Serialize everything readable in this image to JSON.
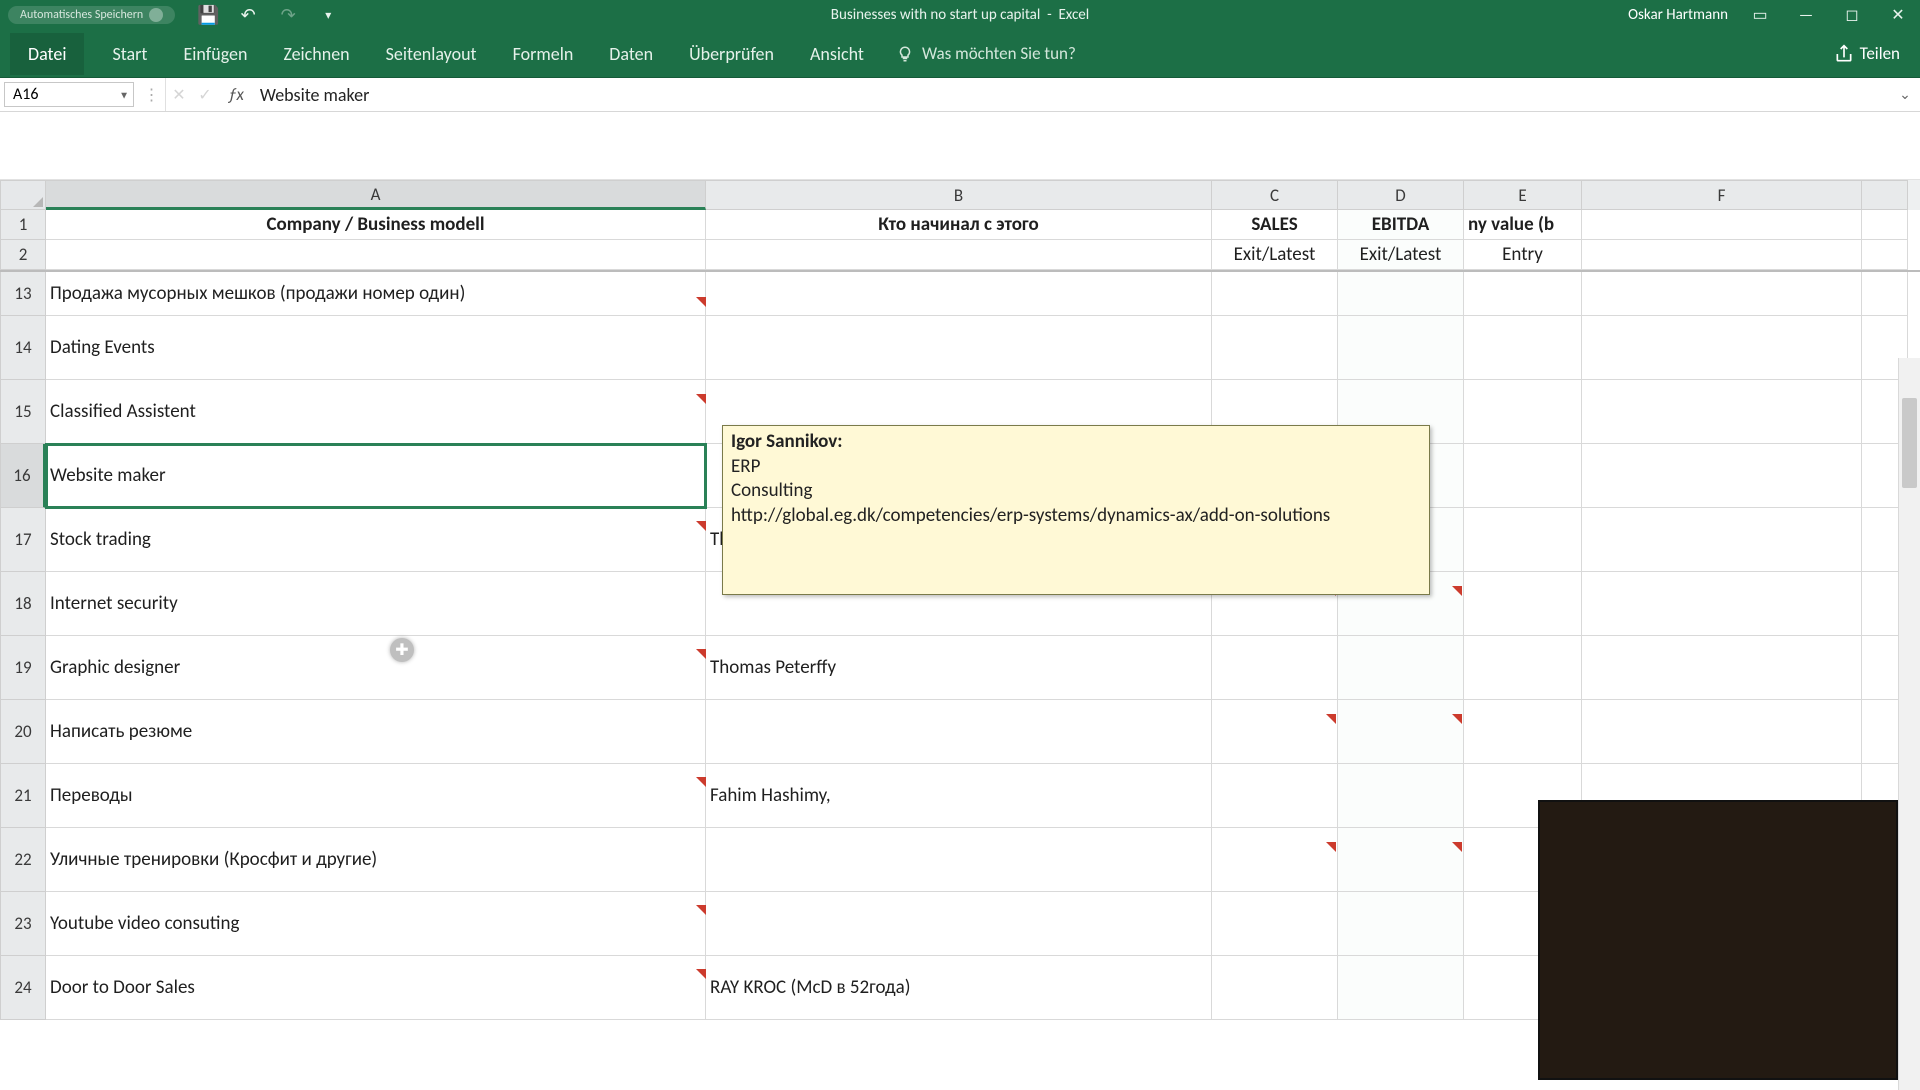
{
  "title": {
    "autosave": "Automatisches Speichern",
    "docname": "Businesses with no start up capital",
    "appname": "Excel",
    "user": "Oskar Hartmann"
  },
  "tabs": {
    "file": "Datei",
    "items": [
      "Start",
      "Einfügen",
      "Zeichnen",
      "Seitenlayout",
      "Formeln",
      "Daten",
      "Überprüfen",
      "Ansicht"
    ],
    "tellme_placeholder": "Was möchten Sie tun?",
    "share": "Teilen"
  },
  "formula": {
    "namebox": "A16",
    "value": "Website maker"
  },
  "columns": [
    "A",
    "B",
    "C",
    "D",
    "E",
    "F"
  ],
  "headers": {
    "A": "Company  / Business modell",
    "B": "Кто начинал с этого",
    "C": "SALES",
    "D": "EBITDA",
    "E_partial": "ny value (b"
  },
  "subheaders": {
    "C": "Exit/Latest",
    "D": "Exit/Latest",
    "E": "Entry"
  },
  "rows": [
    {
      "n": 13,
      "A": "Продажа мусорных мешков (продажи номер один)",
      "B": ""
    },
    {
      "n": 14,
      "A": "Dating Events",
      "B": ""
    },
    {
      "n": 15,
      "A": "Classified Assistent",
      "B": ""
    },
    {
      "n": 16,
      "A": "Website maker",
      "B": ""
    },
    {
      "n": 17,
      "A": "Stock trading",
      "B": "Thomas Peterffy"
    },
    {
      "n": 18,
      "A": "Internet security",
      "B": ""
    },
    {
      "n": 19,
      "A": "Graphic designer",
      "B": "Thomas Peterffy"
    },
    {
      "n": 20,
      "A": "Написать резюме",
      "B": ""
    },
    {
      "n": 21,
      "A": "Переводы",
      "B": "Fahim Hashimy,"
    },
    {
      "n": 22,
      "A": "Уличные тренировки (Кросфит и другие)",
      "B": ""
    },
    {
      "n": 23,
      "A": "Youtube video consuting",
      "B": ""
    },
    {
      "n": 24,
      "A": "Door to Door Sales",
      "B": "RAY KROC (McD в 52года)"
    }
  ],
  "comment": {
    "author": "Igor Sannikov:",
    "line1": "ERP",
    "line2": "Consulting",
    "line3": "http://global.eg.dk/competencies/erp-systems/dynamics-ax/add-on-solutions"
  },
  "selected_row": 16
}
